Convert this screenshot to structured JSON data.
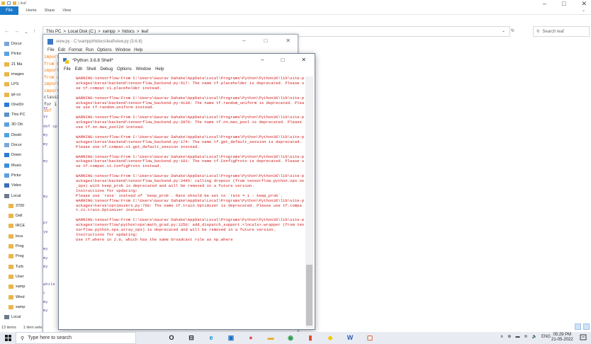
{
  "explorer": {
    "ribbon": {
      "file_tab": "File",
      "home_tab": "Home",
      "share_tab": "Share",
      "view_tab": "View",
      "title_hint": "| leaf"
    },
    "address": [
      "This PC",
      ">",
      "Local Disk (C:)",
      ">",
      "xampp",
      ">",
      "htdocs",
      ">",
      "leaf"
    ],
    "search_placeholder": "Search leaf",
    "nav_items": [
      "Docur",
      "Pictur",
      "21 Ma",
      "images",
      "LPS",
      "ipl-co",
      "OneDri",
      "This PC",
      "3D Ob",
      "Deskt",
      "Docur",
      "Down",
      "Music",
      "Pictur",
      "Video",
      "Local",
      "3700",
      "Dell",
      "IRCE",
      "loca",
      "Prog",
      "Prog",
      "Turb",
      "User",
      "xamp",
      "Wind",
      "xamp",
      "Local"
    ],
    "status": {
      "items": "13 items",
      "selected": "1 item sele"
    }
  },
  "editor": {
    "title": "view.py - C:\\xampp\\htdocs\\leaf\\view.py (3.6.8)",
    "menu": [
      "File",
      "Edit",
      "Format",
      "Run",
      "Options",
      "Window",
      "Help"
    ],
    "code_fragments": [
      {
        "t": "import",
        "c": "kw"
      },
      {
        "t": "from k",
        "c": "kw"
      },
      {
        "t": "import",
        "c": "kw"
      },
      {
        "t": "from d",
        "c": "kw"
      },
      {
        "t": "import",
        "c": "kw"
      },
      {
        "t": "import",
        "c": "kw"
      },
      {
        "t": "classif",
        "c": "bl"
      },
      {
        "t": "for i",
        "c": "bl"
      },
      {
        "t": "def ",
        "c": "kw"
      }
    ]
  },
  "shell": {
    "title": "*Python 3.6.8 Shell*",
    "menu": [
      "File",
      "Edit",
      "Shell",
      "Debug",
      "Options",
      "Window",
      "Help"
    ],
    "gutter": [
      "ff",
      "ff",
      "def up",
      "my",
      "my",
      "",
      "my",
      "",
      "",
      "",
      "my",
      "",
      "",
      "pr",
      "ye",
      "",
      "my",
      "my",
      "my",
      "",
      "while",
      "L",
      "my",
      "my"
    ],
    "output": "WARNING:tensorflow:From C:\\Users\\Gaurav Dahake\\AppData\\Local\\Programs\\Python\\Python36\\lib\\site-packages\\keras\\backend\\tensorflow_backend.py:517: The name tf.placeholder is deprecated. Please use tf.compat.v1.placeholder instead.\n\nWARNING:tensorflow:From C:\\Users\\Gaurav Dahake\\AppData\\Local\\Programs\\Python\\Python36\\lib\\site-packages\\keras\\backend\\tensorflow_backend.py:4138: The name tf.random_uniform is deprecated. Please use tf.random.uniform instead.\n\nWARNING:tensorflow:From C:\\Users\\Gaurav Dahake\\AppData\\Local\\Programs\\Python\\Python36\\lib\\site-packages\\keras\\backend\\tensorflow_backend.py:3976: The name tf.nn.max_pool is deprecated. Please use tf.nn.max_pool2d instead.\n\nWARNING:tensorflow:From C:\\Users\\Gaurav Dahake\\AppData\\Local\\Programs\\Python\\Python36\\lib\\site-packages\\keras\\backend\\tensorflow_backend.py:174: The name tf.get_default_session is deprecated. Please use tf.compat.v1.get_default_session instead.\n\nWARNING:tensorflow:From C:\\Users\\Gaurav Dahake\\AppData\\Local\\Programs\\Python\\Python36\\lib\\site-packages\\keras\\backend\\tensorflow_backend.py:181: The name tf.ConfigProto is deprecated. Please use tf.compat.v1.ConfigProto instead.\n\nWARNING:tensorflow:From C:\\Users\\Gaurav Dahake\\AppData\\Local\\Programs\\Python\\Python36\\lib\\site-packages\\keras\\backend\\tensorflow_backend.py:3445: calling dropout (from tensorflow.python.ops.nn_ops) with keep_prob is deprecated and will be removed in a future version.\nInstructions for updating:\nPlease use `rate` instead of `keep_prob`. Rate should be set to `rate = 1 - keep_prob`.\nWARNING:tensorflow:From C:\\Users\\Gaurav Dahake\\AppData\\Local\\Programs\\Python\\Python36\\lib\\site-packages\\keras\\optimizers.py:790: The name tf.train.Optimizer is deprecated. Please use tf.compat.v1.train.Optimizer instead.\n\nWARNING:tensorflow:From C:\\Users\\Gaurav Dahake\\AppData\\Local\\Programs\\Python\\Python36\\lib\\site-packages\\tensorflow\\python\\ops\\math_grad.py:1250: add_dispatch_support.<locals>.wrapper (from tensorflow.python.ops.array_ops) is deprecated and will be removed in a future version.\nInstructions for updating:\nUse tf.where in 2.0, which has the same broadcast rule as np.where"
  },
  "taskbar": {
    "search_placeholder": "Type here to search",
    "language": "ENG",
    "time": "05:29 PM",
    "date": "21-05-2022"
  },
  "colors": {
    "warning_text": "#d11a1a",
    "file_tab": "#1979ca"
  }
}
